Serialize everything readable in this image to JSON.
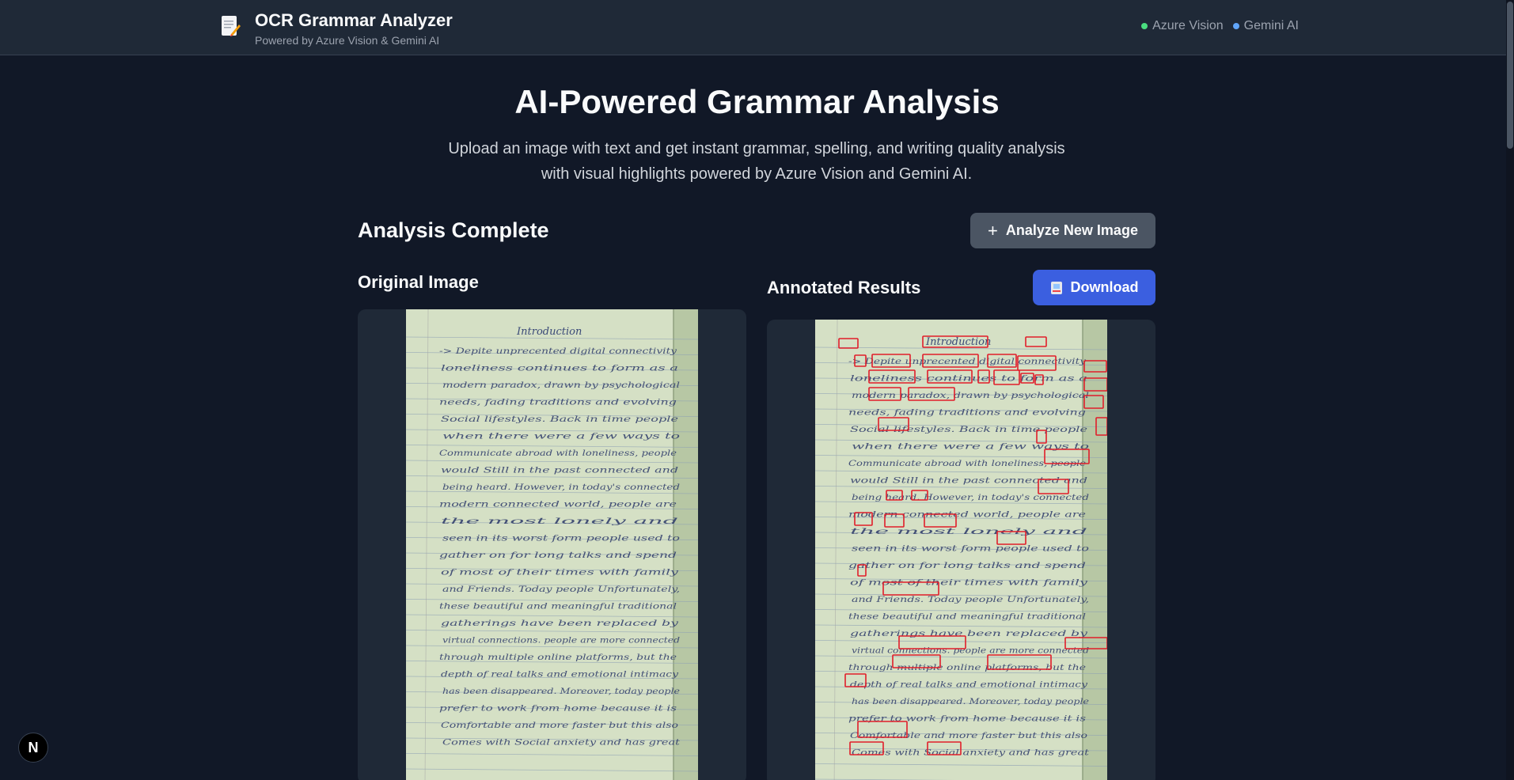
{
  "header": {
    "title": "OCR Grammar Analyzer",
    "subtitle": "Powered by Azure Vision & Gemini AI",
    "logo_icon": "memo-pencil-icon",
    "services": [
      {
        "label": "Azure Vision",
        "color": "#4ade80"
      },
      {
        "label": "Gemini AI",
        "color": "#60a5fa"
      }
    ]
  },
  "hero": {
    "title": "AI-Powered Grammar Analysis",
    "description": "Upload an image with text and get instant grammar, spelling, and writing quality analysis with visual highlights powered by Azure Vision and Gemini AI."
  },
  "analysis": {
    "status_title": "Analysis Complete",
    "new_button_label": "Analyze New Image",
    "original_title": "Original Image",
    "annotated_title": "Annotated Results",
    "download_label": "Download"
  },
  "notebook": {
    "heading": "Introduction",
    "lines": [
      "-> Depite unprecented digital connectivity",
      "loneliness continues to form as a",
      "modern paradox, drawn by psychological",
      "needs, fading traditions and evolving",
      "Social lifestyles. Back in time people",
      "when there were a few ways to",
      "Communicate abroad with loneliness, people",
      "would Still in the past connected and",
      "being heard. However, in today's connected",
      "modern connected world, people are",
      "the most lonely and",
      "seen in its worst form people used to",
      "gather on for long talks and spend",
      "of most of their times with family",
      "and Friends. Today people Unfortunately,",
      "these beautiful and meaningful traditional",
      "gatherings have been replaced by",
      "virtual connections. people are more connected",
      "through multiple online platforms, but the",
      "depth of real talks and emotional intimacy",
      "has been disappeared. Moreover, today people",
      "prefer to work from home because it is",
      "Comfortable and more faster but this also",
      "Comes with Social anxiety and has great"
    ]
  },
  "colors": {
    "background": "#111827",
    "header": "#1f2937",
    "panel": "#1f2937",
    "download_button": "#3b5fe0",
    "new_button": "#4b5563",
    "highlight": "#e11d2a"
  },
  "badge": {
    "label": "N",
    "icon": "nextjs-icon"
  }
}
